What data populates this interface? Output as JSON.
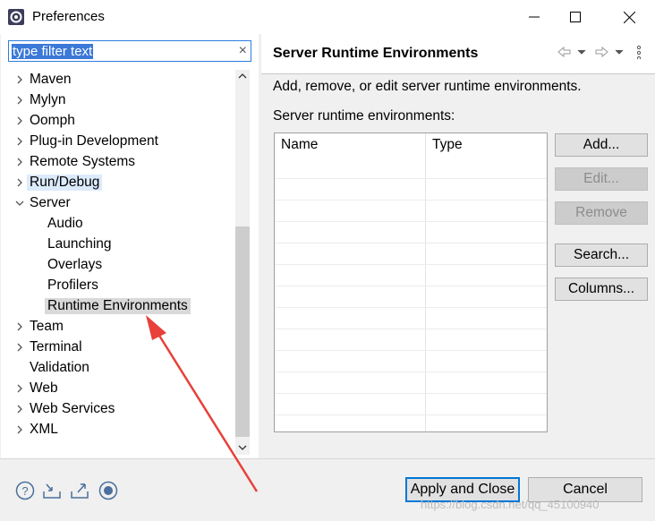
{
  "window": {
    "title": "Preferences",
    "icon": "eclipse-gear-icon"
  },
  "filter": {
    "value": "type filter text",
    "clear_icon": "×"
  },
  "tree": [
    {
      "label": "Maven",
      "expander": "collapsed"
    },
    {
      "label": "Mylyn",
      "expander": "collapsed"
    },
    {
      "label": "Oomph",
      "expander": "collapsed"
    },
    {
      "label": "Plug-in Development",
      "expander": "collapsed"
    },
    {
      "label": "Remote Systems",
      "expander": "collapsed"
    },
    {
      "label": "Run/Debug",
      "expander": "collapsed",
      "highlighted": true
    },
    {
      "label": "Server",
      "expander": "expanded"
    },
    {
      "label": "Audio",
      "expander": "none",
      "child": true
    },
    {
      "label": "Launching",
      "expander": "none",
      "child": true
    },
    {
      "label": "Overlays",
      "expander": "none",
      "child": true
    },
    {
      "label": "Profilers",
      "expander": "none",
      "child": true
    },
    {
      "label": "Runtime Environments",
      "expander": "none",
      "child": true,
      "selected": true
    },
    {
      "label": "Team",
      "expander": "collapsed"
    },
    {
      "label": "Terminal",
      "expander": "collapsed"
    },
    {
      "label": "Validation",
      "expander": "none"
    },
    {
      "label": "Web",
      "expander": "collapsed"
    },
    {
      "label": "Web Services",
      "expander": "collapsed"
    },
    {
      "label": "XML",
      "expander": "collapsed"
    }
  ],
  "page": {
    "title": "Server Runtime Environments",
    "description": "Add, remove, or edit server runtime environments.",
    "list_label": "Server runtime environments:",
    "columns": [
      "Name",
      "Type"
    ],
    "buttons": {
      "add": "Add...",
      "edit": "Edit...",
      "remove": "Remove",
      "search": "Search...",
      "columns": "Columns..."
    }
  },
  "footer": {
    "apply_close": "Apply and Close",
    "cancel": "Cancel",
    "icons": [
      "help-icon",
      "import-icon",
      "export-icon",
      "record-icon"
    ]
  },
  "watermark": "https://blog.csdn.net/qq_45100940",
  "colors": {
    "selection": "#d9d9d9",
    "highlight": "#dcebfc",
    "filter_select": "#3b78d8",
    "arrow": "#e8403a",
    "default_button_border": "#0078d7"
  }
}
